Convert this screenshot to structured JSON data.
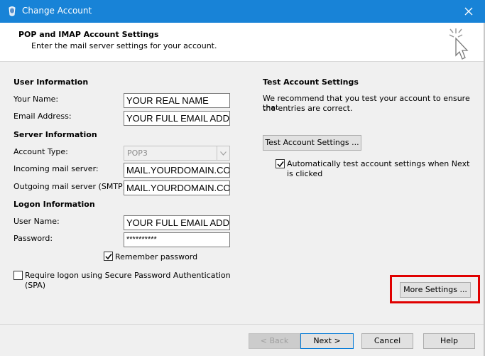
{
  "window": {
    "title": "Change Account"
  },
  "header": {
    "title": "POP and IMAP Account Settings",
    "subtitle": "Enter the mail server settings for your account."
  },
  "user_info": {
    "heading": "User Information",
    "name_label": "Your Name:",
    "name_value": "YOUR REAL NAME",
    "email_label": "Email Address:",
    "email_value": "YOUR FULL EMAIL ADDRESS"
  },
  "server_info": {
    "heading": "Server Information",
    "account_type_label": "Account Type:",
    "account_type_value": "POP3",
    "incoming_label": "Incoming mail server:",
    "incoming_value": "MAIL.YOURDOMAIN.COM",
    "outgoing_label": "Outgoing mail server (SMTP):",
    "outgoing_value": "MAIL.YOURDOMAIN.COM"
  },
  "logon_info": {
    "heading": "Logon Information",
    "username_label": "User Name:",
    "username_value": "YOUR FULL EMAIL ADDRESS",
    "password_label": "Password:",
    "password_value": "**********",
    "remember_label": "Remember password",
    "remember_checked": true,
    "spa_label_line1": "Require logon using Secure Password Authentication",
    "spa_label_line2": "(SPA)",
    "spa_checked": false
  },
  "test_settings": {
    "heading": "Test Account Settings",
    "description_line1": "We recommend that you test your account to ensure that",
    "description_line2": "the entries are correct.",
    "test_button": "Test Account Settings ...",
    "auto_test_line1": "Automatically test account settings when Next",
    "auto_test_line2": "is clicked",
    "auto_test_checked": true
  },
  "more_settings_button": "More Settings ...",
  "footer": {
    "back": "< Back",
    "next": "Next >",
    "cancel": "Cancel",
    "help": "Help"
  },
  "colors": {
    "titlebar": "#1883d7",
    "highlight": "#e00000"
  }
}
